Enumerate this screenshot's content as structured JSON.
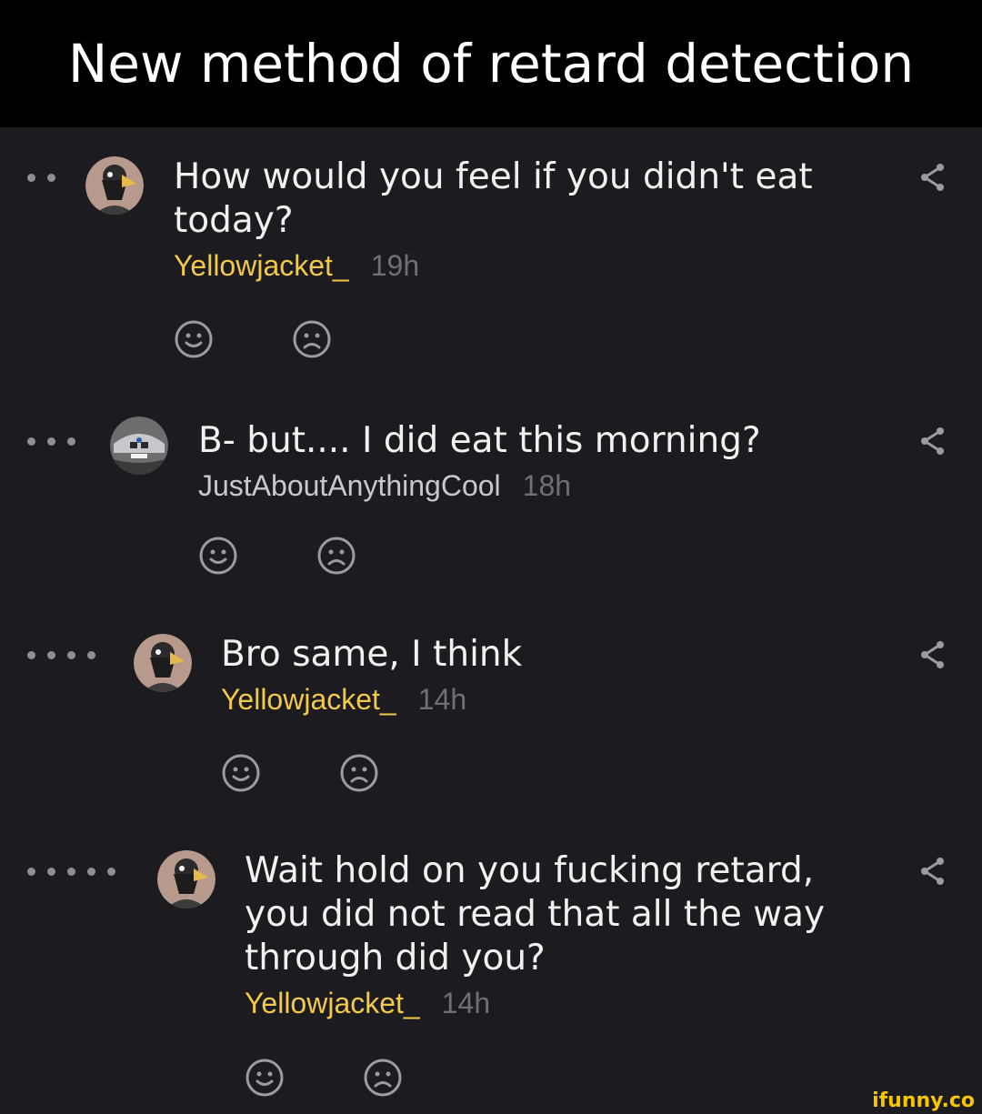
{
  "caption": "New method of retard detection",
  "comments": [
    {
      "text": "How would you feel if you didn't eat today?",
      "author": "Yellowjacket_",
      "time": "19h",
      "depth": 2,
      "avatar": "masked-bird"
    },
    {
      "text": "B- but.... I did eat this morning?",
      "author": "JustAboutAnythingCool",
      "time": "18h",
      "depth": 3,
      "avatar": "car-bmw"
    },
    {
      "text": "Bro same, I think",
      "author": "Yellowjacket_",
      "time": "14h",
      "depth": 4,
      "avatar": "masked-bird"
    },
    {
      "text": "Wait hold on you fucking retard, you did not read that all the way through did you?",
      "author": "Yellowjacket_",
      "time": "14h",
      "depth": 5,
      "avatar": "masked-bird"
    }
  ],
  "icons": {
    "smile": "smile-reaction-icon",
    "frown": "frown-reaction-icon",
    "share": "share-icon"
  },
  "colors": {
    "background": "#1b1b20",
    "author": "#f3c94a",
    "text": "#f1f1f1",
    "muted": "#6f6f75",
    "watermark": "#f7c600"
  },
  "watermark": "ifunny.co"
}
